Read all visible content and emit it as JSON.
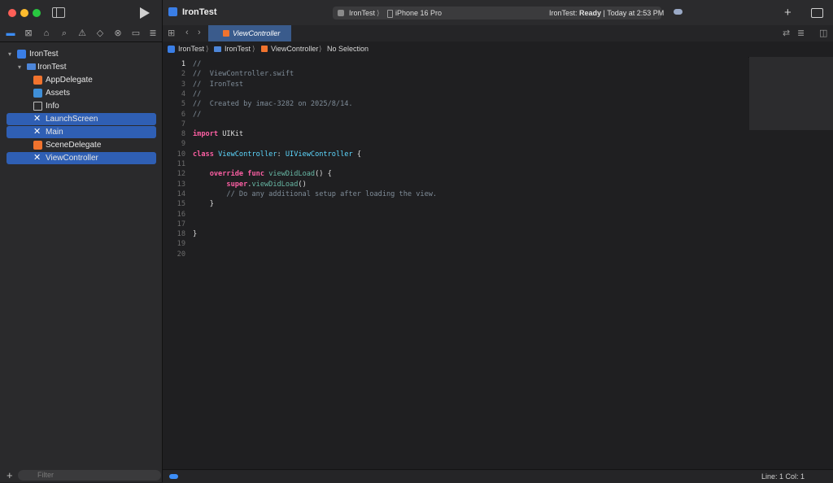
{
  "toolbar": {
    "project_title": "IronTest",
    "scheme": "IronTest",
    "scheme_sep": "⟩",
    "device": "iPhone 16 Pro",
    "status_prefix": "IronTest: ",
    "status_state": "Ready",
    "status_time": " | Today at 2:53 PM",
    "add_label": "+"
  },
  "tab": {
    "label": "ViewController"
  },
  "jumpbar": {
    "crumbs": [
      "IronTest",
      "IronTest",
      "ViewController",
      "No Selection"
    ],
    "sep": "⟩"
  },
  "navigator": {
    "root": "IronTest",
    "group": "IronTest",
    "files": [
      {
        "label": "AppDelegate",
        "icon": "swift-file-icon"
      },
      {
        "label": "Assets",
        "icon": "asset-catalog-icon"
      },
      {
        "label": "Info",
        "icon": "plist-icon"
      },
      {
        "label": "LaunchScreen",
        "icon": "storyboard-icon"
      },
      {
        "label": "Main",
        "icon": "storyboard-icon"
      },
      {
        "label": "SceneDelegate",
        "icon": "swift-file-icon"
      },
      {
        "label": "ViewController",
        "icon": "swift-file-icon"
      }
    ],
    "filter_placeholder": "Filter"
  },
  "editor": {
    "line_numbers": [
      "1",
      "2",
      "3",
      "4",
      "5",
      "6",
      "7",
      "8",
      "9",
      "10",
      "11",
      "12",
      "13",
      "14",
      "15",
      "16",
      "17",
      "18",
      "19",
      "20"
    ],
    "lines": [
      "//",
      "//  ViewController.swift",
      "//  IronTest",
      "//",
      "//  Created by imac-3282 on 2025/8/14.",
      "//",
      "",
      "import UIKit",
      "",
      "class ViewController: UIViewController {",
      "",
      "    override func viewDidLoad() {",
      "        super.viewDidLoad()",
      "        // Do any additional setup after loading the view.",
      "    }",
      "",
      "",
      "}",
      "",
      ""
    ]
  },
  "statusbar": {
    "cursor": "Line: 1  Col: 1"
  },
  "colors": {
    "accent": "#3c8df6",
    "selection": "#2f5fb4",
    "keyword": "#fc5fa3",
    "type": "#5dd8ff"
  }
}
